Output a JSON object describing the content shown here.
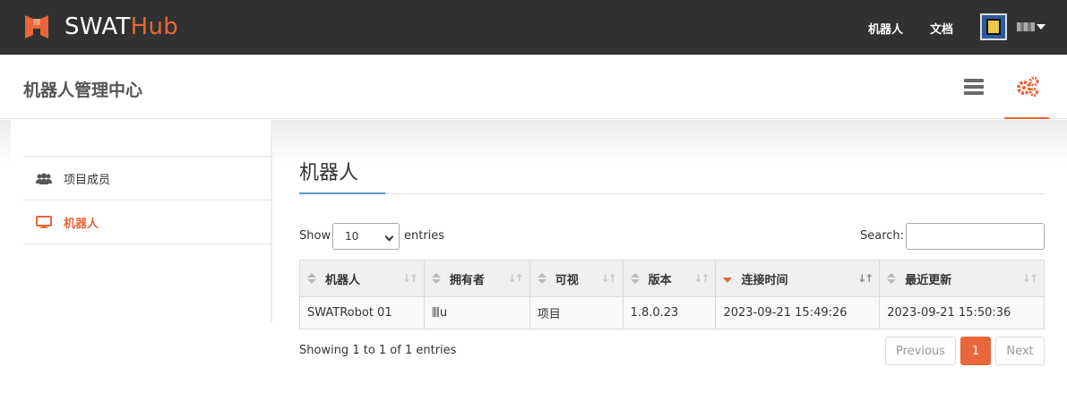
{
  "brand": {
    "text_a": "SWAT",
    "text_b": "Hub"
  },
  "nav": {
    "robots": "机器人",
    "docs": "文档"
  },
  "header": {
    "title": "机器人管理中心"
  },
  "sidebar": {
    "items": [
      {
        "label": "项目成员",
        "icon": "users-icon"
      },
      {
        "label": "机器人",
        "icon": "desktop-icon"
      }
    ]
  },
  "main": {
    "title": "机器人"
  },
  "length": {
    "show": "Show",
    "value": "10",
    "entries": "entries"
  },
  "search": {
    "label": "Search:"
  },
  "table": {
    "columns": [
      "机器人",
      "拥有者",
      "可视",
      "版本",
      "连接时间",
      "最近更新"
    ],
    "rows": [
      {
        "robot": "SWATRobot 01",
        "owner": "u",
        "visible": "项目",
        "version": "1.8.0.23",
        "connected": "2023-09-21 15:49:26",
        "updated": "2023-09-21 15:50:36"
      }
    ]
  },
  "info": "Showing 1 to 1 of 1 entries",
  "pagination": {
    "previous": "Previous",
    "current": "1",
    "next": "Next"
  },
  "colors": {
    "accent": "#e8663a",
    "navbar": "#313131"
  }
}
